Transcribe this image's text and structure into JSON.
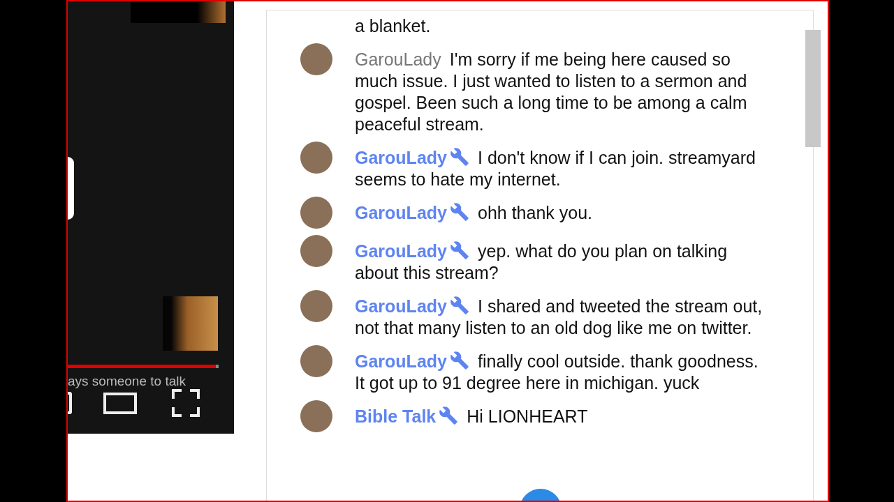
{
  "video": {
    "caption": "ays someone to talk",
    "progress": {
      "level": 0.98
    }
  },
  "chat": {
    "messages": [
      {
        "kind": "continuation",
        "text": "a blanket."
      },
      {
        "kind": "message",
        "author": "GarouLady",
        "moderator": false,
        "text": "I'm sorry if me being here caused so much issue. I just wanted to listen to a sermon and gospel. Been such a long time to be among a calm peaceful stream."
      },
      {
        "kind": "message",
        "author": "GarouLady",
        "moderator": true,
        "text": "I don't know if I can join. streamyard seems to hate my internet."
      },
      {
        "kind": "message",
        "author": "GarouLady",
        "moderator": true,
        "text": "ohh thank you."
      },
      {
        "kind": "message",
        "author": "GarouLady",
        "moderator": true,
        "text": "yep. what do you plan on talking about this stream?"
      },
      {
        "kind": "message",
        "author": "GarouLady",
        "moderator": true,
        "text": "I shared and tweeted the stream out, not that many listen to an old dog like me on twitter."
      },
      {
        "kind": "message",
        "author": "GarouLady",
        "moderator": true,
        "text": "finally cool outside. thank goodness. It got up to 91 degree here in michigan. yuck"
      },
      {
        "kind": "message",
        "author": "Bible Talk",
        "moderator": true,
        "text": "Hi LIONHEART"
      }
    ]
  }
}
